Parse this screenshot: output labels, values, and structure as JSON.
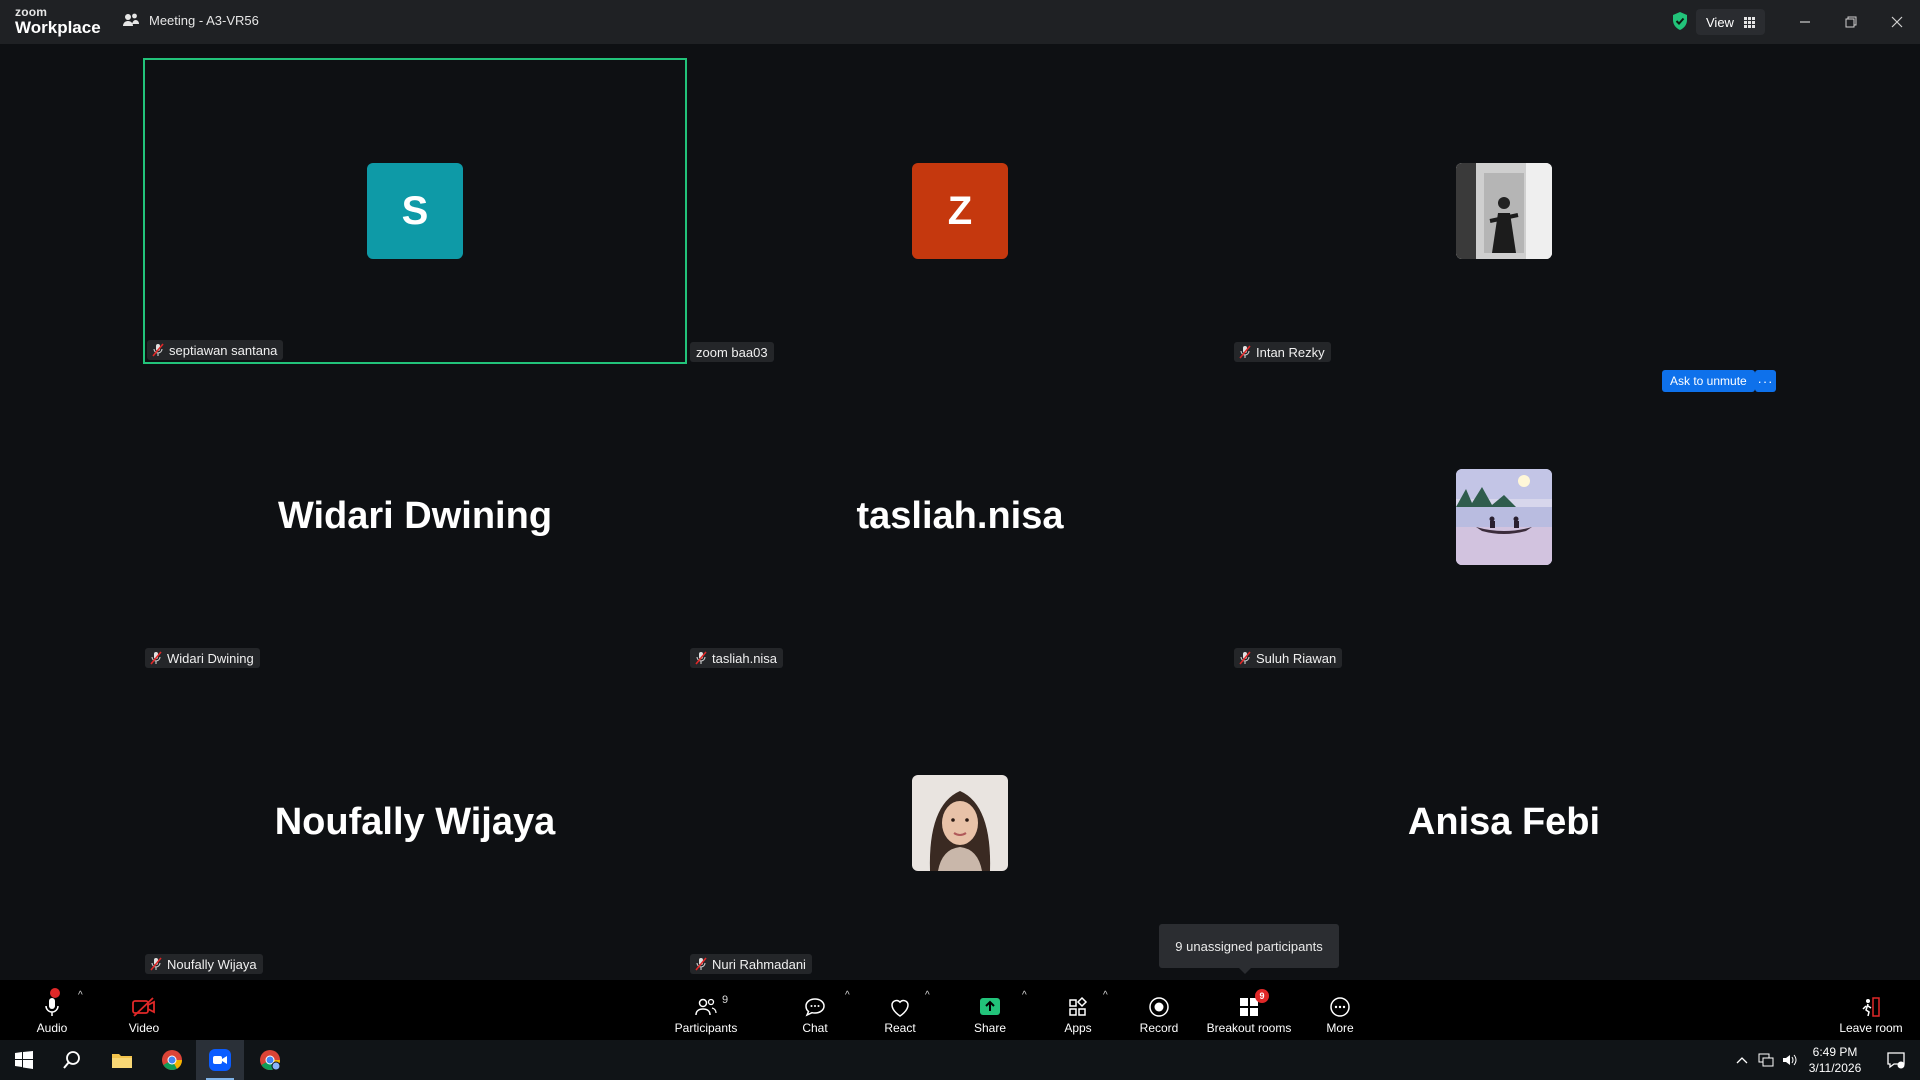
{
  "titlebar": {
    "logo_line1": "zoom",
    "logo_line2": "Workplace",
    "meeting_title": "Meeting - A3-VR56",
    "view_label": "View"
  },
  "tiles": [
    {
      "display": "avatar",
      "initial": "S",
      "color": "#0e9aa7",
      "tag": "septiawan santana",
      "muted": true,
      "active": true
    },
    {
      "display": "avatar",
      "initial": "Z",
      "color": "#c5380e",
      "tag": "zoom baa03",
      "muted": false,
      "active": false
    },
    {
      "display": "photo",
      "photo": "bw-portrait",
      "tag": "Intan Rezky",
      "muted": true,
      "active": false
    },
    {
      "display": "name",
      "name": "Widari Dwining",
      "tag": "Widari Dwining",
      "muted": true,
      "active": false
    },
    {
      "display": "name",
      "name": "tasliah.nisa",
      "tag": "tasliah.nisa",
      "muted": true,
      "active": false
    },
    {
      "display": "photo",
      "photo": "lake-canoe",
      "tag": "Suluh Riawan",
      "muted": true,
      "active": false
    },
    {
      "display": "name",
      "name": "Noufally Wijaya",
      "tag": "Noufally Wijaya",
      "muted": true,
      "active": false
    },
    {
      "display": "photo",
      "photo": "woman-portrait",
      "tag": "Nuri Rahmadani",
      "muted": true,
      "active": false
    },
    {
      "display": "name",
      "name": "Anisa Febi",
      "tag": "",
      "muted": false,
      "active": false
    }
  ],
  "ask_to_unmute": "Ask to unmute",
  "more_dots": "···",
  "tooltip": "9 unassigned participants",
  "toolbar": {
    "audio": "Audio",
    "video": "Video",
    "participants": "Participants",
    "participants_count": "9",
    "chat": "Chat",
    "react": "React",
    "share": "Share",
    "apps": "Apps",
    "record": "Record",
    "breakout": "Breakout rooms",
    "breakout_badge": "9",
    "more": "More",
    "leave": "Leave room"
  },
  "taskbar": {
    "time": "6:49 PM",
    "date": "3/11/2026"
  },
  "colors": {
    "active_border": "#22c37a",
    "accent_blue": "#0e71eb",
    "share_green": "#22c37a",
    "mute_red": "#e02828"
  }
}
